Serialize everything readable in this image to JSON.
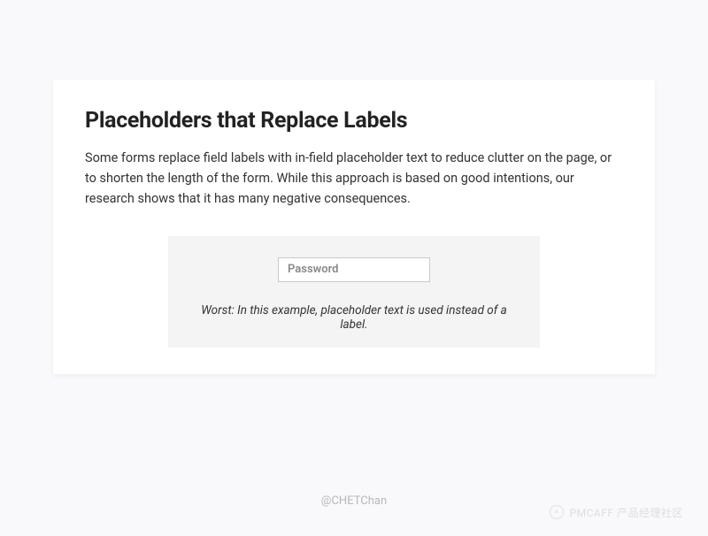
{
  "card": {
    "title": "Placeholders that Replace Labels",
    "body": "Some forms replace field labels with in-field placeholder text to reduce clutter on the page, or to shorten the length of the form. While this approach is based on good intentions, our research shows that it has many negative consequences."
  },
  "example": {
    "input_placeholder": "Password",
    "caption": "Worst: In this example, placeholder text is used instead of a label."
  },
  "footer": {
    "author": "@CHETChan"
  },
  "watermark": {
    "text": "PMCAFF 产品经理社区"
  }
}
